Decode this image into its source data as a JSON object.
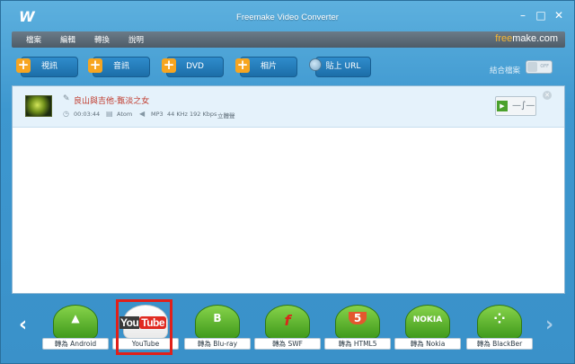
{
  "window": {
    "title": "Freemake Video Converter",
    "logo": "W"
  },
  "menu": {
    "items": [
      "檔案",
      "編輯",
      "轉換",
      "說明"
    ],
    "brand_a": "free",
    "brand_b": "make",
    "brand_c": ".com"
  },
  "toolbar": {
    "video": "視訊",
    "audio": "音訊",
    "dvd": "DVD",
    "photo": "相片",
    "paste_url": "貼上 URL",
    "join_label": "結合檔案",
    "join_state": "OFF"
  },
  "file": {
    "title": "良山與吉他-甄淡之女",
    "duration": "00:03:44",
    "codec_video": "Atom",
    "codec_audio": "MP3",
    "freq": "44 KHz",
    "bitrate": "192 Kbps",
    "channels": "立體聲"
  },
  "converters": [
    {
      "label": "轉為 Android",
      "icon": "android-icon",
      "symbol": "▲"
    },
    {
      "label": "YouTube",
      "icon": "youtube-icon",
      "symbol": ""
    },
    {
      "label": "轉為 Blu-ray",
      "icon": "bluray-icon",
      "symbol": "B"
    },
    {
      "label": "轉為 SWF",
      "icon": "flash-icon",
      "symbol": "f"
    },
    {
      "label": "轉為 HTML5",
      "icon": "html5-icon",
      "symbol": "5"
    },
    {
      "label": "轉為 Nokia",
      "icon": "nokia-icon",
      "symbol": "NOKIA"
    },
    {
      "label": "轉為 BlackBer",
      "icon": "blackberry-icon",
      "symbol": "⁘"
    }
  ],
  "youtube_you": "You",
  "youtube_tube": "Tube",
  "colors": {
    "accent_orange": "#f7a520",
    "highlight_red": "#e0201a",
    "title_red": "#c0392b"
  }
}
